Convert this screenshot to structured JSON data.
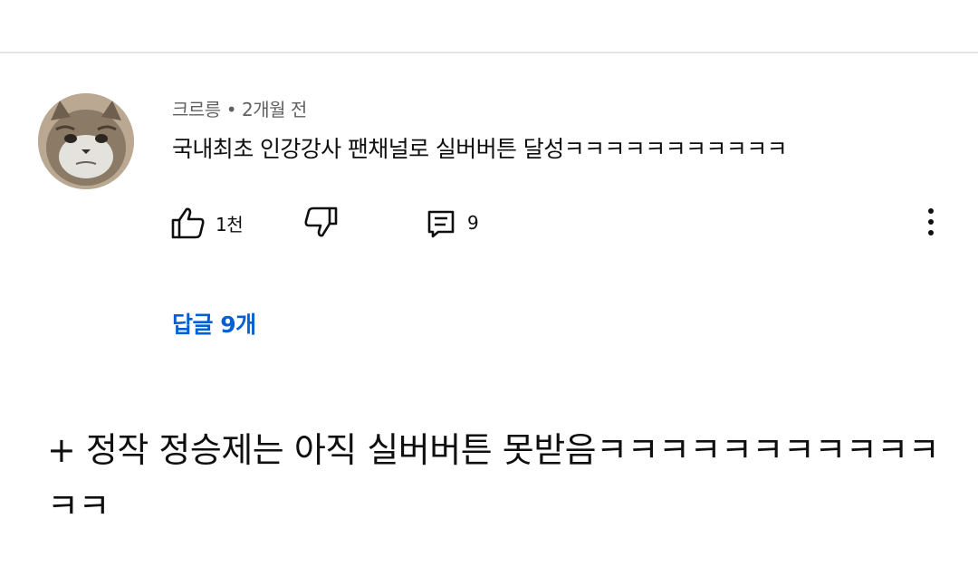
{
  "comment": {
    "author": "크르릉",
    "separator": "•",
    "time": "2개월 전",
    "text": "국내최초 인강강사 팬채널로 실버버튼 달성ㅋㅋㅋㅋㅋㅋㅋㅋㅋㅋㅋ",
    "like_count": "1천",
    "reply_count": "9",
    "replies_link": "답글 9개"
  },
  "caption": {
    "text": "+ 정작 정승제는 아직 실버버튼 못받음ㅋㅋㅋㅋㅋㅋㅋㅋㅋㅋㅋㅋㅋ"
  },
  "icons": {
    "like": "thumbs-up-icon",
    "dislike": "thumbs-down-icon",
    "reply": "reply-comment-icon",
    "more": "more-vertical-icon"
  },
  "colors": {
    "link": "#065fd4",
    "meta": "#606060",
    "text": "#0f0f0f"
  }
}
